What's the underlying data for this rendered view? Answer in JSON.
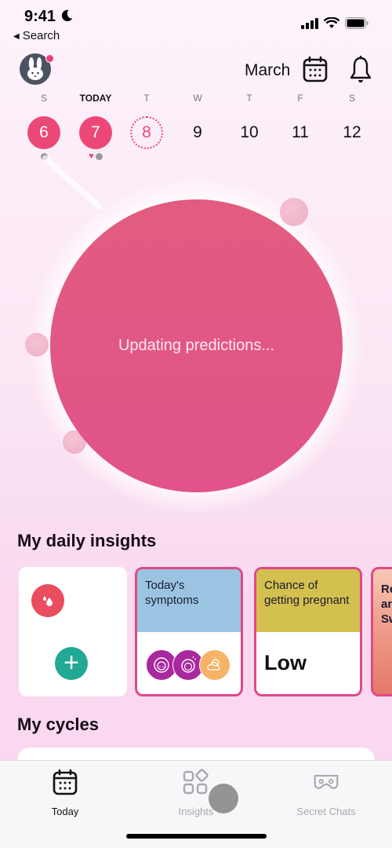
{
  "status_bar": {
    "time": "9:41",
    "focus_icon": "moon-icon",
    "back_label": "Search",
    "icons": [
      "cellular-signal-icon",
      "wifi-icon",
      "battery-icon"
    ]
  },
  "header": {
    "avatar_icon": "bunny-avatar-icon",
    "has_notification_dot": true,
    "month": "March",
    "calendar_icon": "calendar-icon",
    "bell_icon": "bell-icon"
  },
  "week": [
    {
      "letter": "S",
      "day": "6",
      "state": "period",
      "markers": [
        "grey-dot"
      ]
    },
    {
      "letter": "TODAY",
      "day": "7",
      "state": "period",
      "markers": [
        "heart",
        "grey-dot"
      ]
    },
    {
      "letter": "T",
      "day": "8",
      "state": "predicted",
      "markers": []
    },
    {
      "letter": "W",
      "day": "9",
      "state": "normal",
      "markers": []
    },
    {
      "letter": "T",
      "day": "10",
      "state": "normal",
      "markers": []
    },
    {
      "letter": "F",
      "day": "11",
      "state": "normal",
      "markers": []
    },
    {
      "letter": "S",
      "day": "12",
      "state": "normal",
      "markers": []
    }
  ],
  "main_circle": {
    "message": "Updating predictions...",
    "color": "#e1588a"
  },
  "insights": {
    "title": "My daily insights",
    "cards": [
      {
        "type": "log",
        "icon": "period-drop-icon",
        "action_icon": "plus-icon"
      },
      {
        "type": "symptoms",
        "title": "Today's symptoms",
        "header_color": "#9bc4e2",
        "icons": [
          "acne-icon",
          "headache-icon",
          "cloudy-sun-icon"
        ]
      },
      {
        "type": "pregnancy-chance",
        "title": "Chance of getting pregnant",
        "header_color": "#d4c04e",
        "value": "Low"
      },
      {
        "type": "story",
        "title_partial": "Re an Sw"
      }
    ]
  },
  "cycles": {
    "title": "My cycles"
  },
  "tabbar": {
    "tabs": [
      {
        "label": "Today",
        "icon": "calendar-icon",
        "active": true
      },
      {
        "label": "Insights",
        "icon": "grid-shapes-icon",
        "active": false
      },
      {
        "label": "Secret Chats",
        "icon": "mask-icon",
        "active": false
      }
    ]
  },
  "accent_color": "#ec4877"
}
